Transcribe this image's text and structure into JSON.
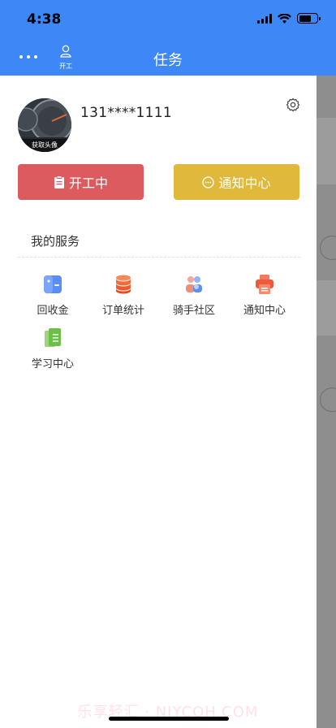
{
  "status_bar": {
    "time": "4:38",
    "battery_level": 0.7
  },
  "nav": {
    "title": "任务",
    "start_work_label": "开工",
    "icons": {
      "more": "more-dots-icon",
      "start_work": "worker-icon"
    }
  },
  "profile": {
    "phone": "131****1111",
    "avatar_caption": "获取头像",
    "icons": {
      "settings": "gear-icon"
    }
  },
  "actions": {
    "start_button_label": "开工中",
    "notice_button_label": "通知中心",
    "colors": {
      "start": "#dc5b5e",
      "notice": "#e0b93c"
    },
    "icons": {
      "start": "clipboard-icon",
      "notice": "chat-bubble-icon"
    }
  },
  "services": {
    "title": "我的服务",
    "items": [
      {
        "label": "回收金",
        "icon": "wallet-icon"
      },
      {
        "label": "订单统计",
        "icon": "database-icon"
      },
      {
        "label": "骑手社区",
        "icon": "community-icon"
      },
      {
        "label": "通知中心",
        "icon": "printer-icon"
      },
      {
        "label": "学习中心",
        "icon": "document-icon"
      }
    ]
  },
  "colors": {
    "header": "#3e87f6"
  },
  "watermark": "乐享轻汇 · NJYCOH.COM"
}
